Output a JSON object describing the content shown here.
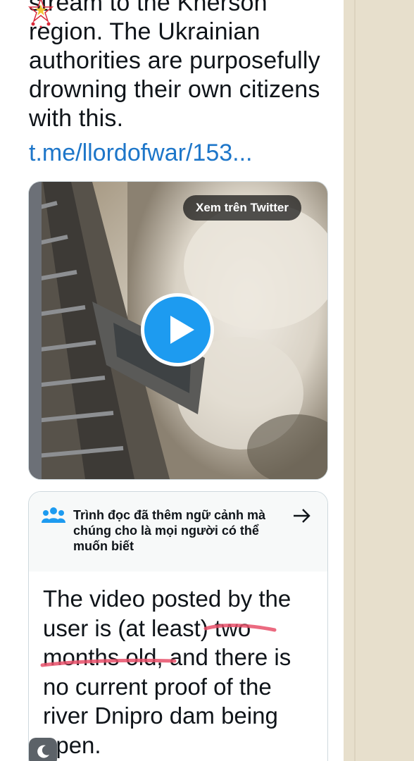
{
  "tweet": {
    "lines": [
      "stream to the Kherson",
      "region. The Ukrainian",
      "authorities are purposefully",
      "drowning their own citizens",
      "with this."
    ],
    "link": "t.me/llordofwar/153..."
  },
  "media": {
    "view_on_twitter": "Xem trên Twitter",
    "play_icon": "play-icon"
  },
  "community_note": {
    "icon": "people-icon",
    "title": "Trình đọc đã thêm ngữ cảnh mà chúng cho là mọi người có thể muốn biết",
    "arrow_icon": "arrow-right-icon",
    "body_lines": [
      "The video posted by the",
      "user is (at least) two",
      "months old, and there is",
      "no current proof of the",
      "river Dnipro dam being",
      "open."
    ]
  },
  "colors": {
    "link": "#1d76c9",
    "play_button": "#1d9bf0",
    "highlight": "#e8506a",
    "page_margin": "#e9e1cf"
  }
}
